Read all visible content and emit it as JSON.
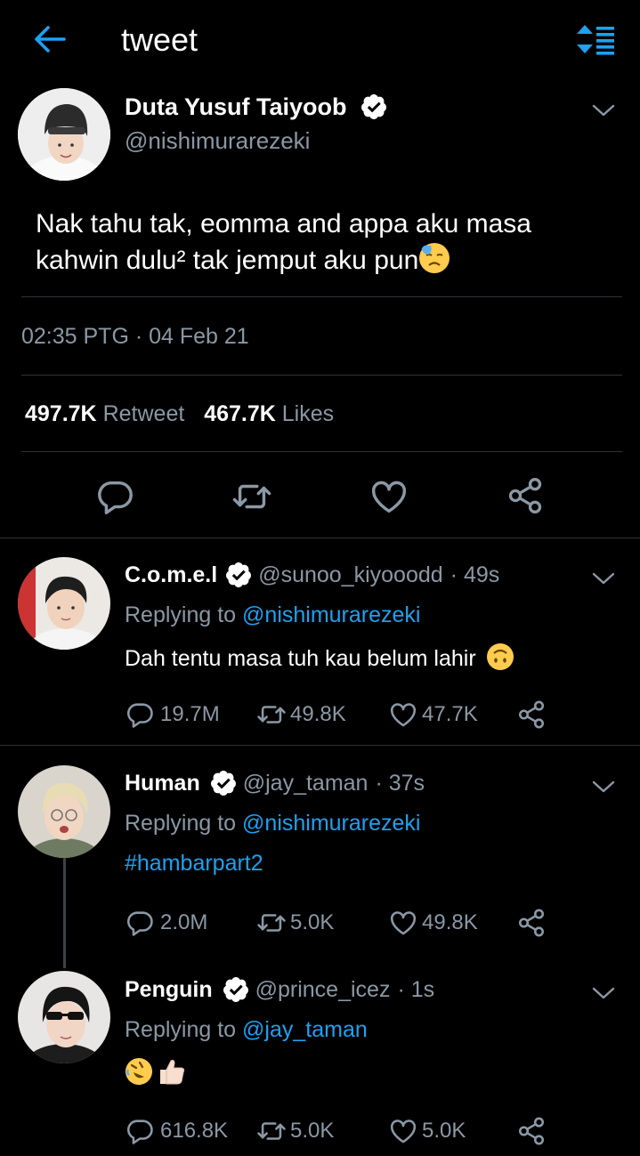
{
  "header": {
    "title": "tweet"
  },
  "tweet": {
    "name": "Duta Yusuf Taiyoob",
    "handle": "@nishimurarezeki",
    "text_line1": "Nak tahu tak, eomma and appa aku masa",
    "text_line2": "kahwin dulu² tak jemput aku pun",
    "time": "02:35 PTG",
    "date": "04 Feb 21",
    "retweet_count": "497.7K",
    "retweet_label": "Retweet",
    "like_count": "467.7K",
    "like_label": "Likes",
    "emoji": "downcast-sweat-face"
  },
  "replies": [
    {
      "name": "C.o.m.e.l",
      "handle": "@sunoo_kiyooodd",
      "age": "· 49s",
      "replying_prefix": "Replying to",
      "replying_to": "@nishimurarezeki",
      "text": "Dah tentu masa tuh kau belum lahir",
      "emoji": "upside-down-face",
      "replies": "19.7M",
      "retweets": "49.8K",
      "likes": "47.7K"
    },
    {
      "name": "Human",
      "handle": "@jay_taman",
      "age": "· 37s",
      "replying_prefix": "Replying to",
      "replying_to": "@nishimurarezeki",
      "text": "#hambarpart2",
      "replies": "2.0M",
      "retweets": "5.0K",
      "likes": "49.8K"
    },
    {
      "name": "Penguin",
      "handle": "@prince_icez",
      "age": "· 1s",
      "replying_prefix": "Replying to",
      "replying_to": "@jay_taman",
      "emoji": [
        "rolling-laughing-face",
        "thumbs-up"
      ],
      "replies": "616.8K",
      "retweets": "5.0K",
      "likes": "5.0K"
    }
  ],
  "colors": {
    "accent": "#1da1f2",
    "muted": "#8b98a5",
    "background": "#000000",
    "divider": "#2f3336"
  }
}
